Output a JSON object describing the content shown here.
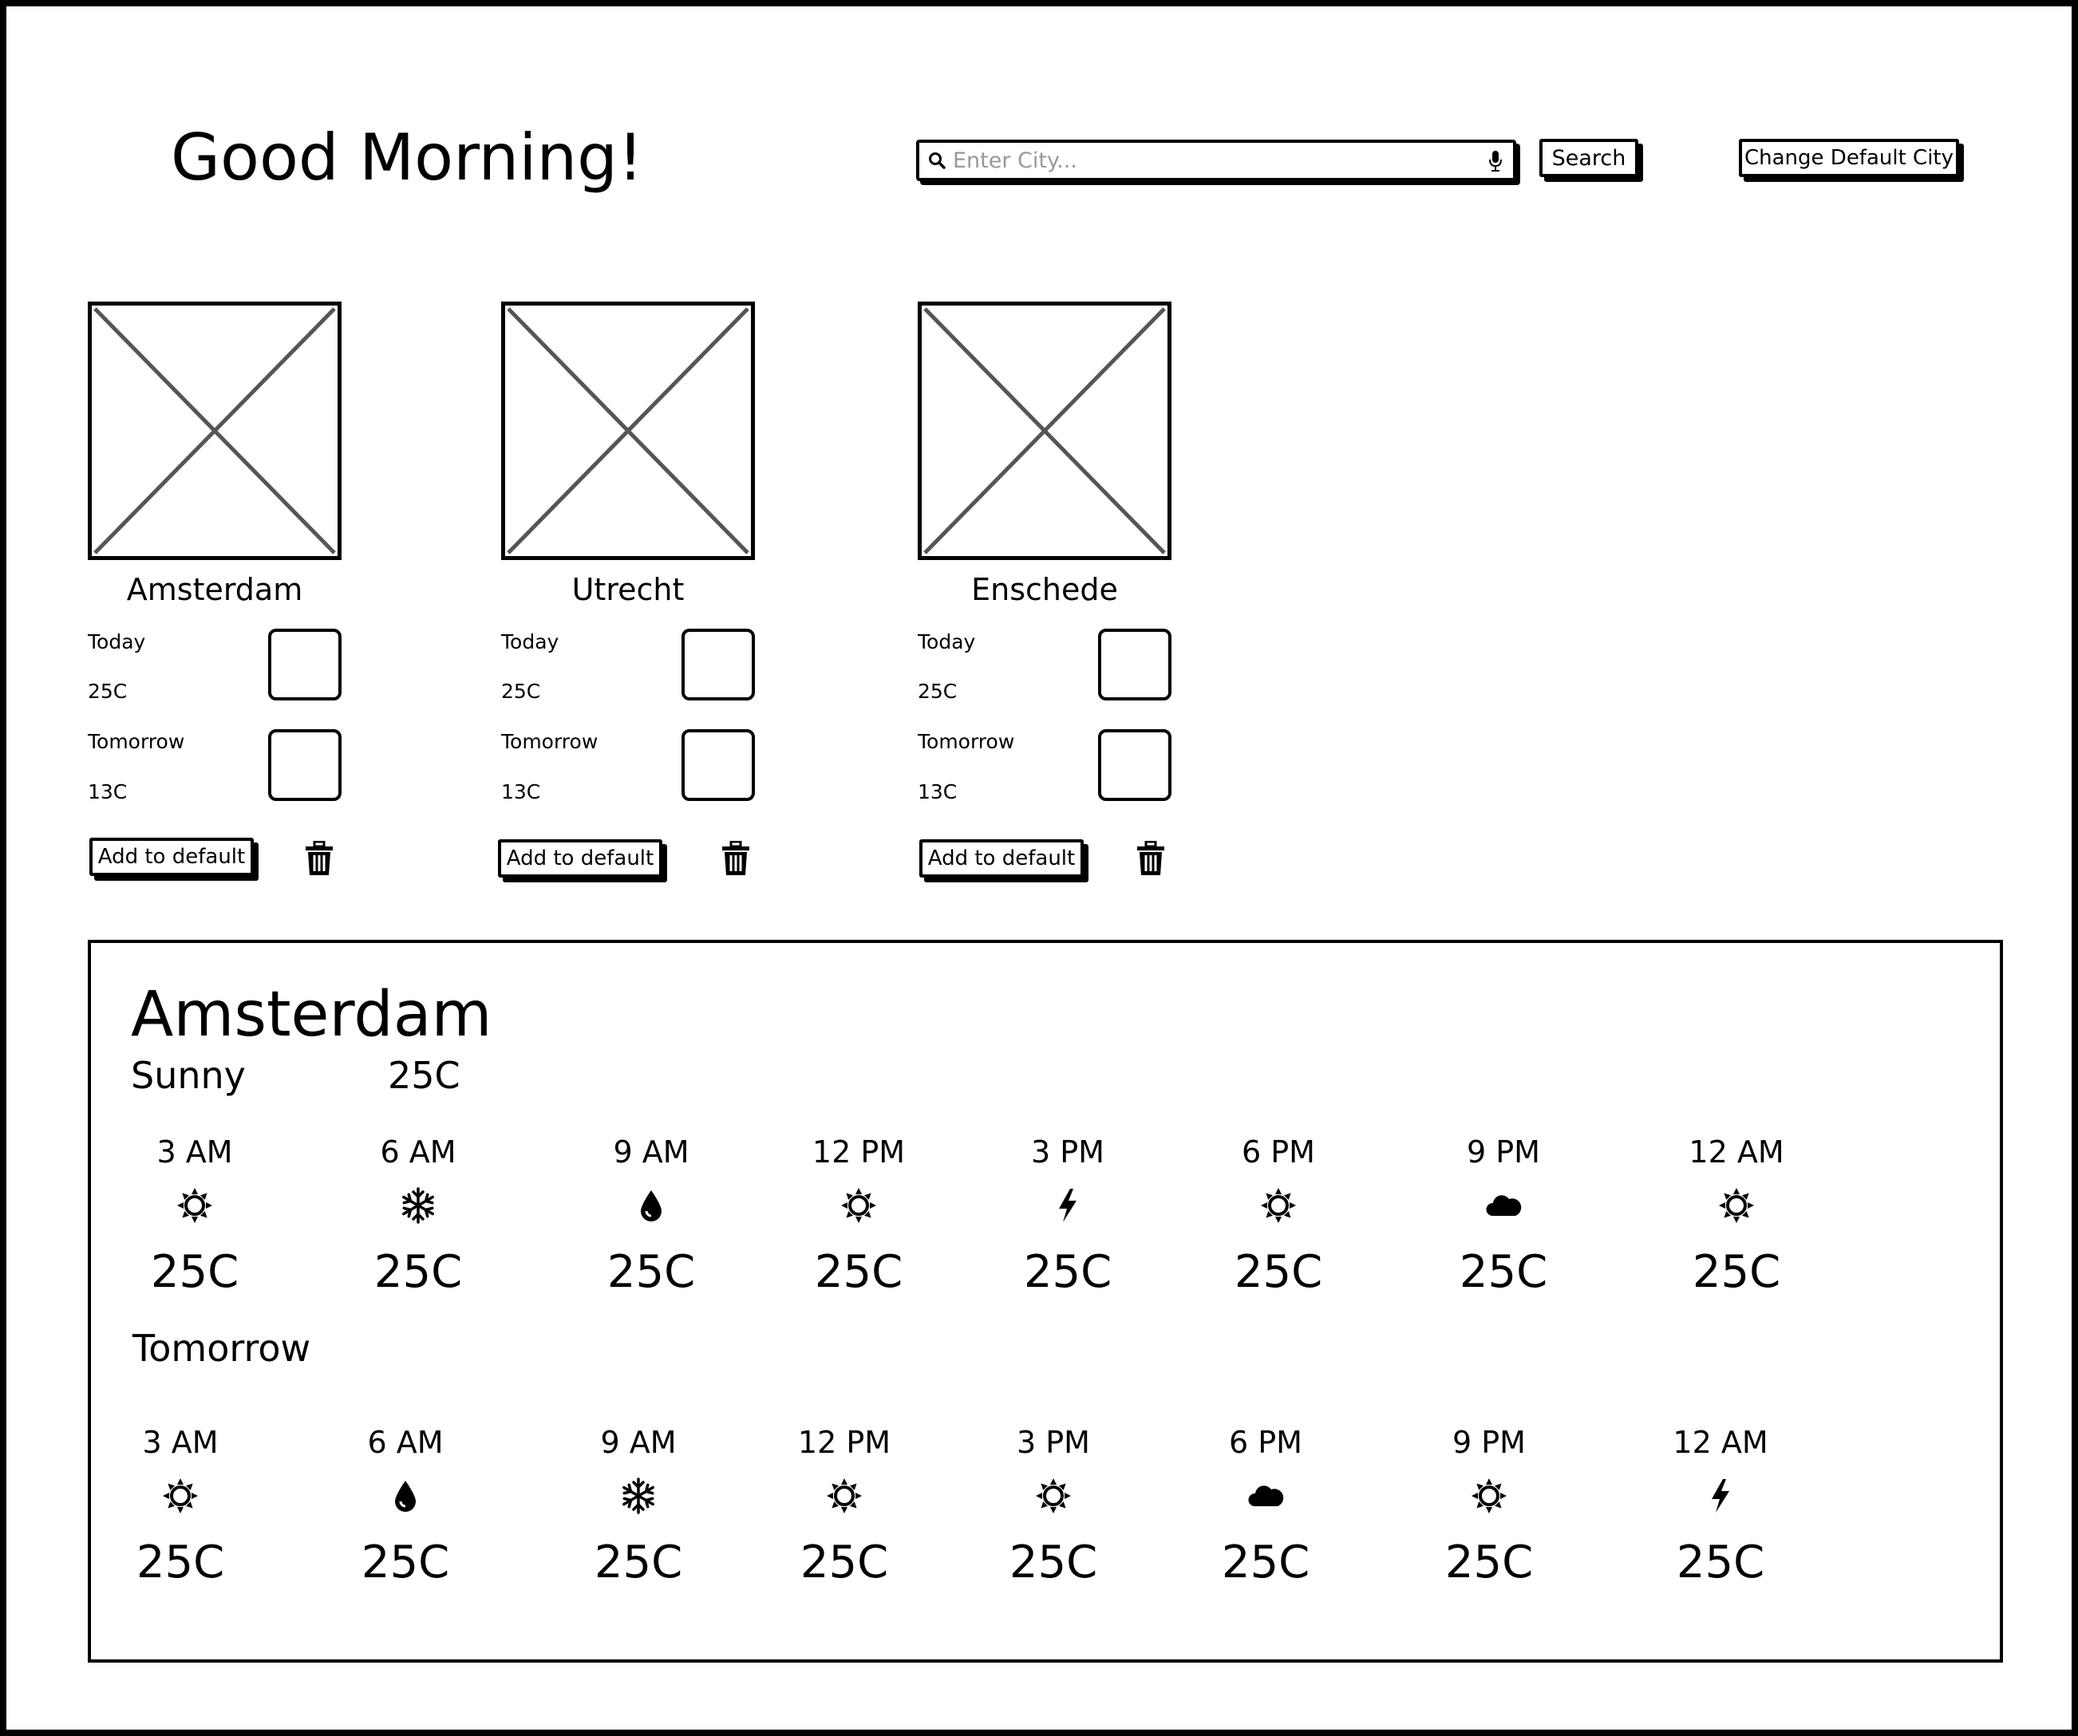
{
  "header": {
    "greeting": "Good Morning!",
    "search_placeholder": "Enter City...",
    "search_button": "Search",
    "change_default_button": "Change Default City"
  },
  "cards": [
    {
      "city": "Amsterdam",
      "today_label": "Today",
      "today_temp": "25C",
      "tomorrow_label": "Tomorrow",
      "tomorrow_temp": "13C",
      "add_button": "Add to default"
    },
    {
      "city": "Utrecht",
      "today_label": "Today",
      "today_temp": "25C",
      "tomorrow_label": "Tomorrow",
      "tomorrow_temp": "13C",
      "add_button": "Add to default"
    },
    {
      "city": "Enschede",
      "today_label": "Today",
      "today_temp": "25C",
      "tomorrow_label": "Tomorrow",
      "tomorrow_temp": "13C",
      "add_button": "Add to default"
    }
  ],
  "detail": {
    "city": "Amsterdam",
    "condition": "Sunny",
    "temp": "25C",
    "tomorrow_label": "Tomorrow",
    "today_hours": [
      {
        "time": "3 AM",
        "icon": "sun-icon",
        "temp": "25C"
      },
      {
        "time": "6 AM",
        "icon": "snowflake-icon",
        "temp": "25C"
      },
      {
        "time": "9 AM",
        "icon": "raindrop-icon",
        "temp": "25C"
      },
      {
        "time": "12 PM",
        "icon": "sun-icon",
        "temp": "25C"
      },
      {
        "time": "3 PM",
        "icon": "lightning-icon",
        "temp": "25C"
      },
      {
        "time": "6 PM",
        "icon": "sun-icon",
        "temp": "25C"
      },
      {
        "time": "9 PM",
        "icon": "cloud-icon",
        "temp": "25C"
      },
      {
        "time": "12 AM",
        "icon": "sun-icon",
        "temp": "25C"
      }
    ],
    "tomorrow_hours": [
      {
        "time": "3 AM",
        "icon": "sun-icon",
        "temp": "25C"
      },
      {
        "time": "6 AM",
        "icon": "raindrop-icon",
        "temp": "25C"
      },
      {
        "time": "9 AM",
        "icon": "snowflake-icon",
        "temp": "25C"
      },
      {
        "time": "12 PM",
        "icon": "sun-icon",
        "temp": "25C"
      },
      {
        "time": "3 PM",
        "icon": "sun-icon",
        "temp": "25C"
      },
      {
        "time": "6 PM",
        "icon": "cloud-icon",
        "temp": "25C"
      },
      {
        "time": "9 PM",
        "icon": "sun-icon",
        "temp": "25C"
      },
      {
        "time": "12 AM",
        "icon": "lightning-icon",
        "temp": "25C"
      }
    ]
  }
}
